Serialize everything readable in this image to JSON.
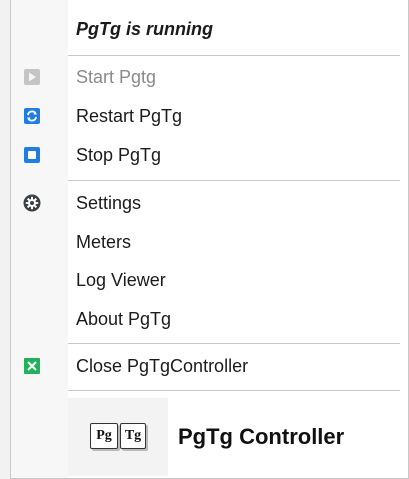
{
  "menu": {
    "header": "PgTg is running",
    "items": [
      {
        "label": "Start Pgtg",
        "icon": "play-icon",
        "disabled": true
      },
      {
        "label": "Restart PgTg",
        "icon": "restart-icon"
      },
      {
        "label": "Stop PgTg",
        "icon": "stop-icon"
      },
      {
        "label": "Settings",
        "icon": "gear-icon"
      },
      {
        "label": "Meters"
      },
      {
        "label": "Log Viewer"
      },
      {
        "label": "About PgTg"
      },
      {
        "label": "Close PgTgController",
        "icon": "close-icon"
      }
    ]
  },
  "logo": {
    "box1": "Pg",
    "box2": "Tg",
    "title": "PgTg Controller"
  },
  "colors": {
    "disabled_icon": "#b9b9b9",
    "blue_icon": "#1f7fe0",
    "green_icon": "#21b15a",
    "gear_icon": "#3a3f45"
  }
}
